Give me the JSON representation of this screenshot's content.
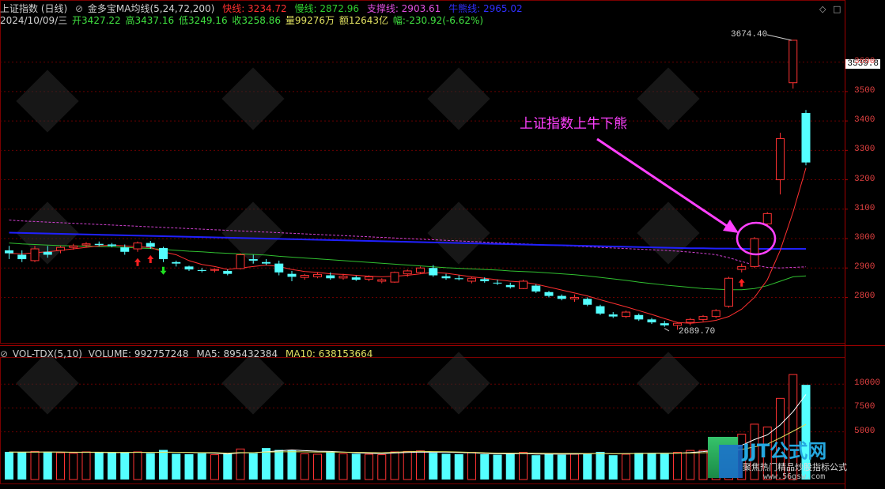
{
  "header": {
    "index_name": "上证指数 (日线)",
    "indicator": "金多宝MA均线(5,24,72,200)",
    "fast_line": "快线: 3234.72",
    "slow_line": "慢线: 2872.96",
    "support_line": "支撑线: 2903.61",
    "bull_bear_line": "牛熊线: 2965.02",
    "date": "2024/10/09/三",
    "open": "开3427.22",
    "high": "高3437.16",
    "low": "低3249.16",
    "close": "收3258.86",
    "volume": "量99276万",
    "amount": "额12643亿",
    "change": "幅:-230.92(-6.62%)"
  },
  "vol_header": {
    "name": "VOL-TDX(5,10)",
    "volume": "VOLUME: 992757248",
    "ma5": "MA5: 895432384",
    "ma10": "MA10: 638153664"
  },
  "annotation": "上证指数上牛下熊",
  "current_price_tag": "3539.8",
  "high_label": "3674.40",
  "low_label": "2689.70",
  "watermark": {
    "title": "JJT公式网",
    "subtitle": "聚焦热门精品炒股指标公式",
    "url": "www.56gsw.com"
  },
  "colors": {
    "up": "#ff3232",
    "down": "#54ffff",
    "fast_line": "#ff3030",
    "slow_line": "#30c030",
    "support_line": "#d040d0",
    "bull_bear_line": "#2020ff",
    "annotation": "#ff40ff"
  },
  "chart_data": [
    {
      "type": "candlestick",
      "title": "上证指数 (日线)",
      "y_axis_ticks": [
        2800,
        2900,
        3000,
        3100,
        3200,
        3300,
        3400,
        3500,
        3600
      ],
      "ylim": [
        2640,
        3720
      ],
      "candles": [
        {
          "o": 2960,
          "h": 2975,
          "l": 2930,
          "c": 2950
        },
        {
          "o": 2945,
          "h": 2960,
          "l": 2920,
          "c": 2930
        },
        {
          "o": 2925,
          "h": 2975,
          "l": 2920,
          "c": 2965
        },
        {
          "o": 2955,
          "h": 2975,
          "l": 2935,
          "c": 2945
        },
        {
          "o": 2960,
          "h": 2975,
          "l": 2950,
          "c": 2970
        },
        {
          "o": 2970,
          "h": 2982,
          "l": 2962,
          "c": 2975
        },
        {
          "o": 2978,
          "h": 2988,
          "l": 2970,
          "c": 2982
        },
        {
          "o": 2982,
          "h": 2990,
          "l": 2974,
          "c": 2978
        },
        {
          "o": 2980,
          "h": 2985,
          "l": 2970,
          "c": 2975
        },
        {
          "o": 2970,
          "h": 2980,
          "l": 2945,
          "c": 2955
        },
        {
          "o": 2965,
          "h": 2990,
          "l": 2955,
          "c": 2985
        },
        {
          "o": 2985,
          "h": 2992,
          "l": 2965,
          "c": 2972
        },
        {
          "o": 2968,
          "h": 2972,
          "l": 2920,
          "c": 2930
        },
        {
          "o": 2920,
          "h": 2925,
          "l": 2905,
          "c": 2915
        },
        {
          "o": 2905,
          "h": 2908,
          "l": 2890,
          "c": 2895
        },
        {
          "o": 2893,
          "h": 2900,
          "l": 2885,
          "c": 2890
        },
        {
          "o": 2892,
          "h": 2898,
          "l": 2885,
          "c": 2895
        },
        {
          "o": 2890,
          "h": 2895,
          "l": 2875,
          "c": 2880
        },
        {
          "o": 2898,
          "h": 2950,
          "l": 2895,
          "c": 2945
        },
        {
          "o": 2930,
          "h": 2945,
          "l": 2915,
          "c": 2925
        },
        {
          "o": 2920,
          "h": 2930,
          "l": 2910,
          "c": 2915
        },
        {
          "o": 2915,
          "h": 2925,
          "l": 2875,
          "c": 2885
        },
        {
          "o": 2880,
          "h": 2890,
          "l": 2855,
          "c": 2870
        },
        {
          "o": 2868,
          "h": 2880,
          "l": 2860,
          "c": 2875
        },
        {
          "o": 2870,
          "h": 2885,
          "l": 2865,
          "c": 2878
        },
        {
          "o": 2875,
          "h": 2885,
          "l": 2860,
          "c": 2865
        },
        {
          "o": 2866,
          "h": 2880,
          "l": 2860,
          "c": 2872
        },
        {
          "o": 2868,
          "h": 2874,
          "l": 2856,
          "c": 2860
        },
        {
          "o": 2862,
          "h": 2875,
          "l": 2855,
          "c": 2870
        },
        {
          "o": 2855,
          "h": 2865,
          "l": 2848,
          "c": 2860
        },
        {
          "o": 2852,
          "h": 2888,
          "l": 2850,
          "c": 2885
        },
        {
          "o": 2880,
          "h": 2895,
          "l": 2870,
          "c": 2890
        },
        {
          "o": 2885,
          "h": 2905,
          "l": 2880,
          "c": 2900
        },
        {
          "o": 2900,
          "h": 2910,
          "l": 2870,
          "c": 2875
        },
        {
          "o": 2872,
          "h": 2880,
          "l": 2860,
          "c": 2865
        },
        {
          "o": 2865,
          "h": 2875,
          "l": 2858,
          "c": 2862
        },
        {
          "o": 2855,
          "h": 2870,
          "l": 2848,
          "c": 2865
        },
        {
          "o": 2862,
          "h": 2868,
          "l": 2850,
          "c": 2855
        },
        {
          "o": 2850,
          "h": 2860,
          "l": 2842,
          "c": 2848
        },
        {
          "o": 2842,
          "h": 2850,
          "l": 2830,
          "c": 2835
        },
        {
          "o": 2830,
          "h": 2860,
          "l": 2828,
          "c": 2855
        },
        {
          "o": 2840,
          "h": 2845,
          "l": 2815,
          "c": 2820
        },
        {
          "o": 2818,
          "h": 2822,
          "l": 2800,
          "c": 2805
        },
        {
          "o": 2805,
          "h": 2810,
          "l": 2790,
          "c": 2795
        },
        {
          "o": 2795,
          "h": 2810,
          "l": 2785,
          "c": 2800
        },
        {
          "o": 2795,
          "h": 2800,
          "l": 2770,
          "c": 2775
        },
        {
          "o": 2770,
          "h": 2775,
          "l": 2740,
          "c": 2745
        },
        {
          "o": 2742,
          "h": 2750,
          "l": 2730,
          "c": 2735
        },
        {
          "o": 2735,
          "h": 2755,
          "l": 2730,
          "c": 2750
        },
        {
          "o": 2740,
          "h": 2745,
          "l": 2720,
          "c": 2725
        },
        {
          "o": 2725,
          "h": 2730,
          "l": 2710,
          "c": 2715
        },
        {
          "o": 2712,
          "h": 2720,
          "l": 2700,
          "c": 2705
        },
        {
          "o": 2705,
          "h": 2715,
          "l": 2690,
          "c": 2712
        },
        {
          "o": 2715,
          "h": 2730,
          "l": 2705,
          "c": 2725
        },
        {
          "o": 2725,
          "h": 2740,
          "l": 2718,
          "c": 2735
        },
        {
          "o": 2735,
          "h": 2760,
          "l": 2730,
          "c": 2755
        },
        {
          "o": 2770,
          "h": 2870,
          "l": 2765,
          "c": 2865
        },
        {
          "o": 2895,
          "h": 2915,
          "l": 2885,
          "c": 2905
        },
        {
          "o": 2905,
          "h": 3005,
          "l": 2900,
          "c": 3000
        },
        {
          "o": 3050,
          "h": 3090,
          "l": 3040,
          "c": 3085
        },
        {
          "o": 3200,
          "h": 3360,
          "l": 3150,
          "c": 3340
        },
        {
          "o": 3530,
          "h": 3674.4,
          "l": 3510,
          "c": 3674.4
        },
        {
          "o": 3427.22,
          "h": 3437.16,
          "l": 3249.16,
          "c": 3258.86
        }
      ],
      "ma_fast": [
        2950,
        2948,
        2952,
        2955,
        2960,
        2965,
        2970,
        2975,
        2978,
        2975,
        2972,
        2970,
        2955,
        2945,
        2925,
        2912,
        2905,
        2895,
        2900,
        2905,
        2910,
        2905,
        2895,
        2888,
        2885,
        2880,
        2878,
        2875,
        2872,
        2870,
        2872,
        2875,
        2880,
        2885,
        2882,
        2876,
        2870,
        2865,
        2860,
        2855,
        2852,
        2845,
        2835,
        2825,
        2815,
        2805,
        2792,
        2780,
        2768,
        2755,
        2742,
        2728,
        2715,
        2712,
        2716,
        2722,
        2735,
        2760,
        2800,
        2860,
        2960,
        3090,
        3240
      ],
      "ma_slow": [
        2985,
        2982,
        2980,
        2978,
        2976,
        2975,
        2974,
        2973,
        2972,
        2970,
        2968,
        2966,
        2963,
        2960,
        2957,
        2955,
        2952,
        2950,
        2948,
        2946,
        2944,
        2940,
        2937,
        2934,
        2931,
        2928,
        2925,
        2922,
        2919,
        2916,
        2913,
        2910,
        2907,
        2904,
        2901,
        2899,
        2897,
        2895,
        2893,
        2890,
        2888,
        2886,
        2883,
        2880,
        2877,
        2873,
        2868,
        2863,
        2858,
        2852,
        2847,
        2842,
        2838,
        2834,
        2830,
        2828,
        2826,
        2826,
        2830,
        2840,
        2855,
        2870,
        2873
      ],
      "ma_support": [
        3063,
        3060,
        3058,
        3056,
        3054,
        3052,
        3050,
        3048,
        3046,
        3044,
        3042,
        3040,
        3038,
        3036,
        3034,
        3032,
        3030,
        3028,
        3026,
        3024,
        3022,
        3020,
        3018,
        3016,
        3014,
        3012,
        3010,
        3008,
        3006,
        3004,
        3002,
        3000,
        2998,
        2996,
        2994,
        2992,
        2990,
        2988,
        2986,
        2984,
        2982,
        2980,
        2978,
        2976,
        2974,
        2972,
        2970,
        2968,
        2966,
        2964,
        2962,
        2960,
        2957,
        2954,
        2950,
        2945,
        2935,
        2922,
        2910,
        2902,
        2900,
        2902,
        2904
      ],
      "ma_bullbear": [
        3020,
        3019,
        3018,
        3017,
        3016,
        3015,
        3014,
        3013,
        3012,
        3011,
        3010,
        3009,
        3008,
        3007,
        3006,
        3005,
        3004,
        3003,
        3002,
        3001,
        3000,
        2999,
        2998,
        2997,
        2996,
        2995,
        2994,
        2993,
        2992,
        2991,
        2990,
        2989,
        2988,
        2987,
        2986,
        2985,
        2984,
        2983,
        2982,
        2981,
        2980,
        2979,
        2978,
        2977,
        2976,
        2975,
        2974,
        2973,
        2972,
        2971,
        2970,
        2969,
        2968,
        2967,
        2967,
        2966,
        2966,
        2965,
        2965,
        2965,
        2965,
        2965,
        2965
      ]
    },
    {
      "type": "bar",
      "title": "VOL-TDX(5,10)",
      "y_axis_ticks": [
        5000,
        7500,
        10000
      ],
      "ylim": [
        0,
        12500
      ],
      "volumes": [
        2900,
        2850,
        2950,
        2900,
        2800,
        2750,
        2900,
        2850,
        2800,
        2850,
        2900,
        2750,
        3100,
        2700,
        2650,
        2750,
        2600,
        2700,
        3200,
        2750,
        3300,
        3100,
        3100,
        2700,
        2650,
        2900,
        2700,
        2700,
        2650,
        2600,
        2900,
        2950,
        3000,
        2800,
        2700,
        2650,
        2850,
        2650,
        2600,
        2700,
        2850,
        2550,
        2650,
        2600,
        2650,
        2700,
        2900,
        2550,
        2650,
        2800,
        2750,
        2700,
        2850,
        3050,
        3050,
        3300,
        4050,
        4750,
        5800,
        5500,
        8500,
        11000,
        9920
      ],
      "ma5": [
        2880,
        2870,
        2880,
        2890,
        2880,
        2850,
        2860,
        2840,
        2820,
        2830,
        2860,
        2830,
        2880,
        2860,
        2840,
        2800,
        2760,
        2680,
        2790,
        2800,
        2910,
        3010,
        3090,
        3030,
        2970,
        2950,
        2880,
        2800,
        2750,
        2710,
        2780,
        2840,
        2880,
        2870,
        2870,
        2830,
        2800,
        2730,
        2700,
        2690,
        2730,
        2670,
        2670,
        2660,
        2670,
        2690,
        2750,
        2690,
        2710,
        2740,
        2760,
        2760,
        2760,
        2830,
        2930,
        3060,
        3270,
        3580,
        4190,
        4680,
        5720,
        7110,
        8910
      ],
      "ma10": [
        2880,
        2875,
        2878,
        2880,
        2875,
        2870,
        2868,
        2862,
        2855,
        2850,
        2855,
        2850,
        2860,
        2855,
        2850,
        2820,
        2810,
        2760,
        2820,
        2810,
        2880,
        2900,
        2920,
        2900,
        2880,
        2880,
        2870,
        2860,
        2830,
        2800,
        2860,
        2920,
        2960,
        2930,
        2920,
        2890,
        2850,
        2800,
        2760,
        2760,
        2760,
        2750,
        2740,
        2730,
        2730,
        2720,
        2730,
        2710,
        2710,
        2720,
        2740,
        2740,
        2760,
        2770,
        2800,
        2860,
        2990,
        3160,
        3420,
        3710,
        4360,
        5060,
        5780
      ]
    }
  ]
}
